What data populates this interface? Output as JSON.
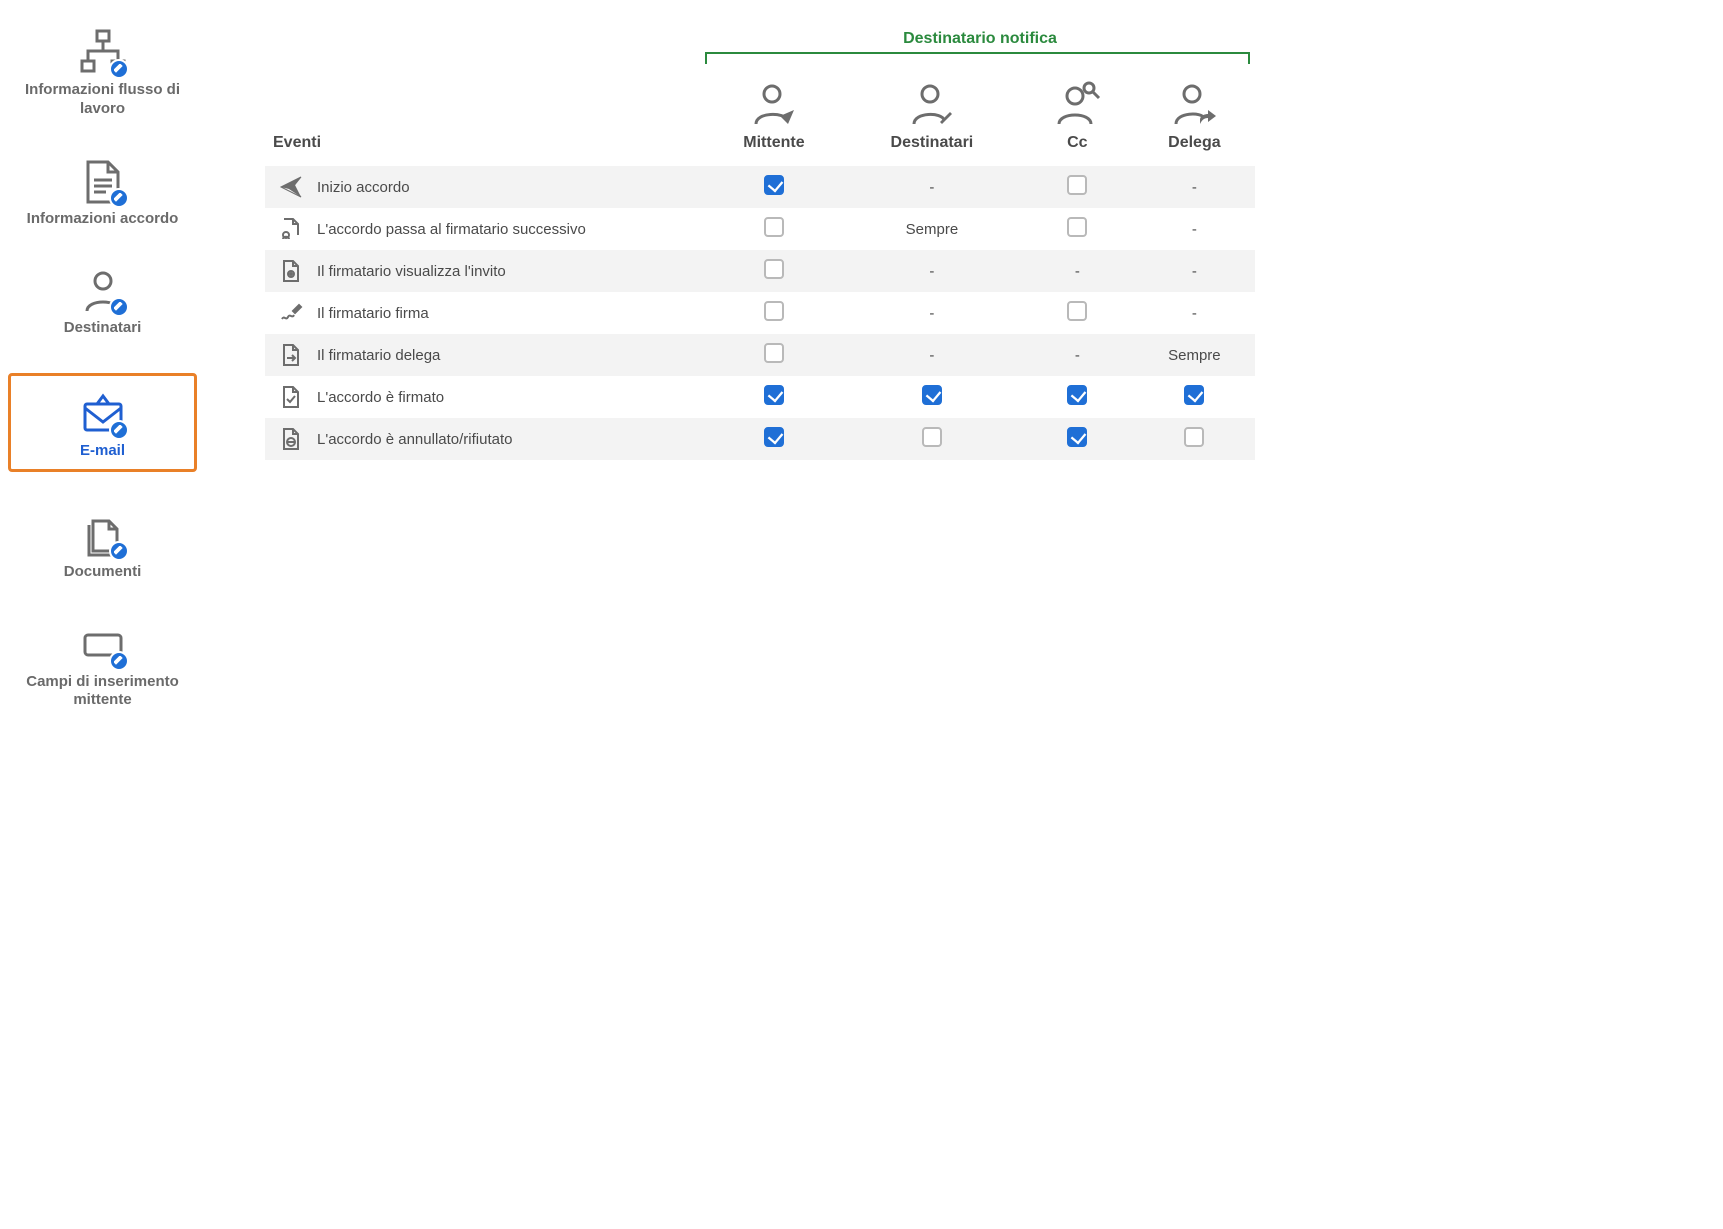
{
  "sidebar": {
    "items": [
      {
        "id": "workflow-info",
        "label": "Informazioni flusso di lavoro"
      },
      {
        "id": "agreement-info",
        "label": "Informazioni accordo"
      },
      {
        "id": "recipients",
        "label": "Destinatari"
      },
      {
        "id": "email",
        "label": "E-mail",
        "active": true
      },
      {
        "id": "documents",
        "label": "Documenti"
      },
      {
        "id": "sender-input-fields",
        "label": "Campi di inserimento mittente"
      }
    ]
  },
  "table": {
    "group_label": "Destinatario notifica",
    "columns": {
      "events": "Eventi",
      "sender": "Mittente",
      "recipients": "Destinatari",
      "cc": "Cc",
      "delegate": "Delega"
    },
    "always_text": "Sempre",
    "rows": [
      {
        "id": "agreement-start",
        "label": "Inizio accordo",
        "sender": {
          "type": "checkbox",
          "checked": true
        },
        "recipients": {
          "type": "dash"
        },
        "cc": {
          "type": "checkbox",
          "checked": false
        },
        "delegate": {
          "type": "dash"
        }
      },
      {
        "id": "next-signer",
        "label": "L'accordo passa al firmatario successivo",
        "sender": {
          "type": "checkbox",
          "checked": false
        },
        "recipients": {
          "type": "always"
        },
        "cc": {
          "type": "checkbox",
          "checked": false
        },
        "delegate": {
          "type": "dash"
        }
      },
      {
        "id": "signer-views",
        "label": "Il firmatario visualizza l'invito",
        "sender": {
          "type": "checkbox",
          "checked": false
        },
        "recipients": {
          "type": "dash"
        },
        "cc": {
          "type": "dash"
        },
        "delegate": {
          "type": "dash"
        }
      },
      {
        "id": "signer-signs",
        "label": "Il firmatario firma",
        "sender": {
          "type": "checkbox",
          "checked": false
        },
        "recipients": {
          "type": "dash"
        },
        "cc": {
          "type": "checkbox",
          "checked": false
        },
        "delegate": {
          "type": "dash"
        }
      },
      {
        "id": "signer-delegates",
        "label": "Il firmatario delega",
        "sender": {
          "type": "checkbox",
          "checked": false
        },
        "recipients": {
          "type": "dash"
        },
        "cc": {
          "type": "dash"
        },
        "delegate": {
          "type": "always"
        }
      },
      {
        "id": "agreement-signed",
        "label": "L'accordo è firmato",
        "sender": {
          "type": "checkbox",
          "checked": true
        },
        "recipients": {
          "type": "checkbox",
          "checked": true
        },
        "cc": {
          "type": "checkbox",
          "checked": true
        },
        "delegate": {
          "type": "checkbox",
          "checked": true
        }
      },
      {
        "id": "agreement-cancelled",
        "label": "L'accordo è annullato/rifiutato",
        "sender": {
          "type": "checkbox",
          "checked": true
        },
        "recipients": {
          "type": "checkbox",
          "checked": false
        },
        "cc": {
          "type": "checkbox",
          "checked": true
        },
        "delegate": {
          "type": "checkbox",
          "checked": false
        }
      }
    ]
  }
}
